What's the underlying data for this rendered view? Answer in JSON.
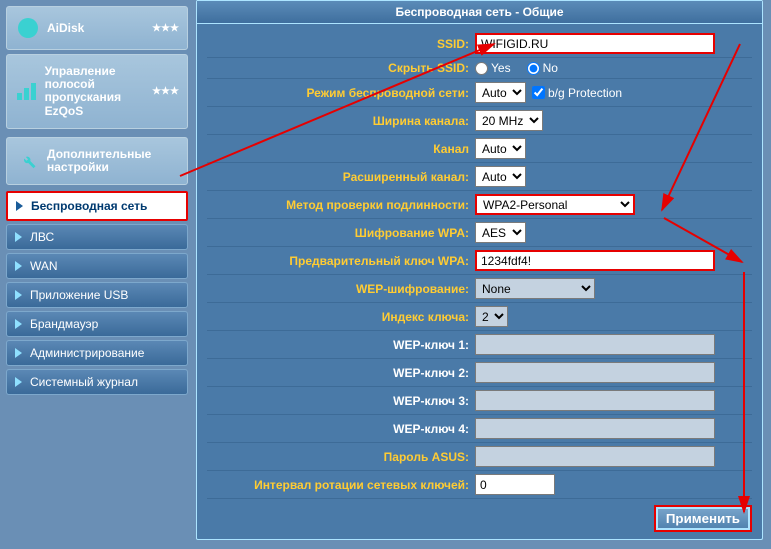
{
  "sidebar": {
    "aidisk": "AiDisk",
    "ezqos_l1": "Управление",
    "ezqos_l2": "полосой",
    "ezqos_l3": "пропускания EzQoS",
    "advanced_l1": "Дополнительные",
    "advanced_l2": "настройки",
    "active": "Беспроводная сеть",
    "items": [
      "ЛВС",
      "WAN",
      "Приложение USB",
      "Брандмауэр",
      "Администрирование",
      "Системный журнал"
    ]
  },
  "panel": {
    "title": "Беспроводная сеть - Общие",
    "labels": {
      "ssid": "SSID:",
      "hide_ssid": "Скрыть SSID:",
      "mode": "Режим беспроводной сети:",
      "width": "Ширина канала:",
      "channel": "Канал",
      "ext_channel": "Расширенный канал:",
      "auth": "Метод проверки подлинности:",
      "wpa_enc": "Шифрование WPA:",
      "wpa_key": "Предварительный ключ WPA:",
      "wep_enc": "WEP-шифрование:",
      "key_index": "Индекс ключа:",
      "wep1": "WEP-ключ 1:",
      "wep2": "WEP-ключ 2:",
      "wep3": "WEP-ключ 3:",
      "wep4": "WEP-ключ 4:",
      "asus_pass": "Пароль ASUS:",
      "rotation": "Интервал ротации сетевых ключей:"
    },
    "values": {
      "ssid": "WIFIGID.RU",
      "yes": "Yes",
      "no": "No",
      "mode": "Auto",
      "bg_protect": "b/g Protection",
      "width": "20 MHz",
      "channel": "Auto",
      "ext_channel": "Auto",
      "auth": "WPA2-Personal",
      "wpa_enc": "AES",
      "wpa_key": "1234fdf4!",
      "wep_enc": "None",
      "key_index": "2",
      "rotation": "0"
    },
    "apply": "Применить"
  }
}
